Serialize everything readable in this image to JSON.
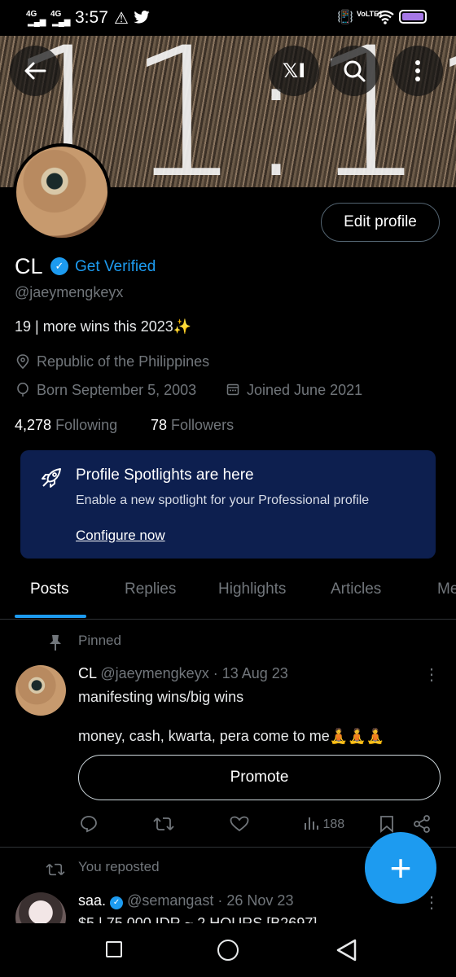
{
  "status_bar": {
    "signal1": "4G",
    "signal2": "4G",
    "time": "3:57",
    "volte": "VoLTE1"
  },
  "banner": {
    "clock_text": "11:11"
  },
  "header": {
    "grok_label": "𝕏I"
  },
  "profile": {
    "edit_label": "Edit profile",
    "name": "CL",
    "get_verified": "Get Verified",
    "handle": "@jaeymengkeyx",
    "bio": "19 | more wins this 2023✨",
    "location": "Republic of the Philippines",
    "born": "Born September 5, 2003",
    "joined": "Joined June 2021",
    "following_count": "4,278",
    "following_label": "Following",
    "followers_count": "78",
    "followers_label": "Followers"
  },
  "spotlight": {
    "title": "Profile Spotlights are here",
    "subtitle": "Enable a new spotlight for your Professional profile",
    "link": "Configure now"
  },
  "tabs": [
    {
      "label": "Posts"
    },
    {
      "label": "Replies"
    },
    {
      "label": "Highlights"
    },
    {
      "label": "Articles"
    },
    {
      "label": "Me"
    }
  ],
  "pinned_post": {
    "pinned_label": "Pinned",
    "name": "CL",
    "handle": "@jaeymengkeyx",
    "date": "· 13 Aug 23",
    "line1": "manifesting wins/big wins",
    "line2": "money, cash, kwarta, pera come to me🧘🧘🧘",
    "promote_label": "Promote",
    "views": "188"
  },
  "repost": {
    "reposted_label": "You reposted",
    "name": "saa.",
    "handle": "@semangast",
    "date": "· 26 Nov 23",
    "text_preview": "$5 | 75.000 IDR ~ 2 HOURS [B2697]"
  },
  "colors": {
    "accent": "#1d9bf0",
    "card_bg": "#0d1f4f",
    "muted": "#71767b"
  }
}
